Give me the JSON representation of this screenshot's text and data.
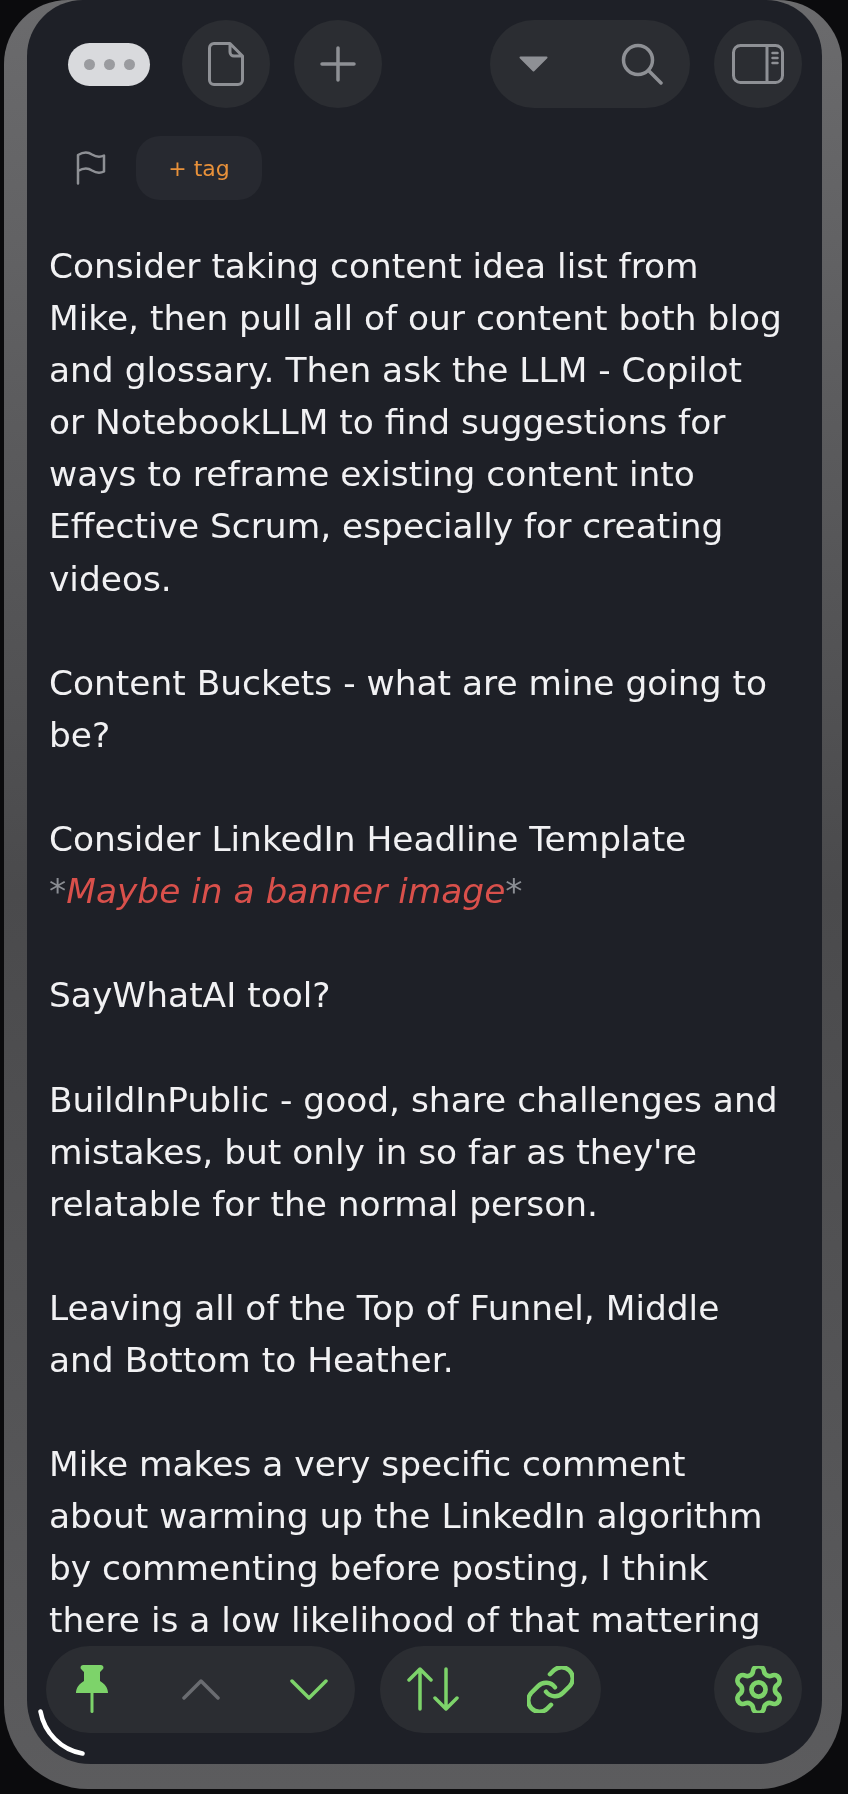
{
  "tag_bar": {
    "add_tag_label": "+ tag"
  },
  "note": {
    "paragraphs": [
      {
        "kind": "text",
        "text": "Consider taking content idea list from Mike, then pull all of our content both blog and glossary. Then ask the LLM - Copilot or NotebookLLM to find suggestions for ways to reframe existing content into Effective Scrum, especially for creating videos."
      },
      {
        "kind": "text",
        "text": "Content Buckets - what are mine going to be?"
      },
      {
        "kind": "text_with_italic",
        "text": "Consider LinkedIn Headline Template",
        "italic": {
          "open_marker": "*",
          "text": "Maybe in a banner image",
          "close_marker": "*"
        }
      },
      {
        "kind": "text",
        "text": "SayWhatAI tool?"
      },
      {
        "kind": "text",
        "text": "BuildInPublic - good, share challenges and mistakes, but only in so far as they're relatable for the normal person."
      },
      {
        "kind": "text",
        "text": "Leaving all of the Top of Funnel, Middle and Bottom to Heather."
      },
      {
        "kind": "text",
        "text": "Mike makes a very specific comment about warming up the LinkedIn algorithm by commenting before posting, I think there is a low likelihood of that mattering"
      }
    ]
  },
  "bottom_toolbar": {
    "previous": {
      "disabled": true
    },
    "next": {
      "disabled": false
    }
  }
}
